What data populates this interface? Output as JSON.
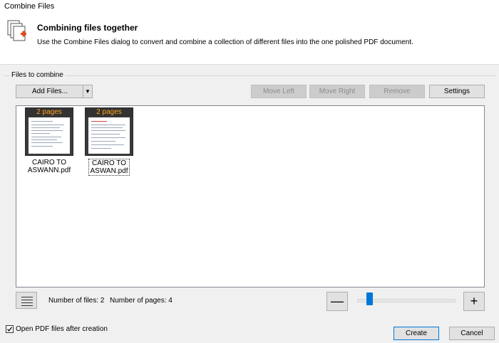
{
  "window": {
    "title": "Combine Files"
  },
  "header": {
    "icon": "combine-files-icon",
    "title": "Combining files together",
    "subtitle": "Use the Combine Files dialog to convert and combine a collection of different files into the one polished PDF document."
  },
  "files_group": {
    "label": "Files to combine"
  },
  "toolbar": {
    "add_files": "Add Files...",
    "move_left": "Move Left",
    "move_right": "Move Right",
    "remove": "Remove",
    "settings": "Settings"
  },
  "files": [
    {
      "pages_badge": "2 pages",
      "name_line1": "CAIRO TO",
      "name_line2": "ASWANN.pdf",
      "focused": false
    },
    {
      "pages_badge": "2 pages",
      "name_line1": "CAIRO TO",
      "name_line2": "ASWAN.pdf",
      "focused": true
    }
  ],
  "status": {
    "num_files": "Number of files: 2",
    "num_pages": "Number of pages: 4"
  },
  "zoom": {
    "minus": "—",
    "plus": "+",
    "level_fraction": 0.1
  },
  "footer": {
    "open_after_label": "Open PDF files after creation",
    "open_after_checked": true,
    "create": "Create",
    "cancel": "Cancel"
  }
}
